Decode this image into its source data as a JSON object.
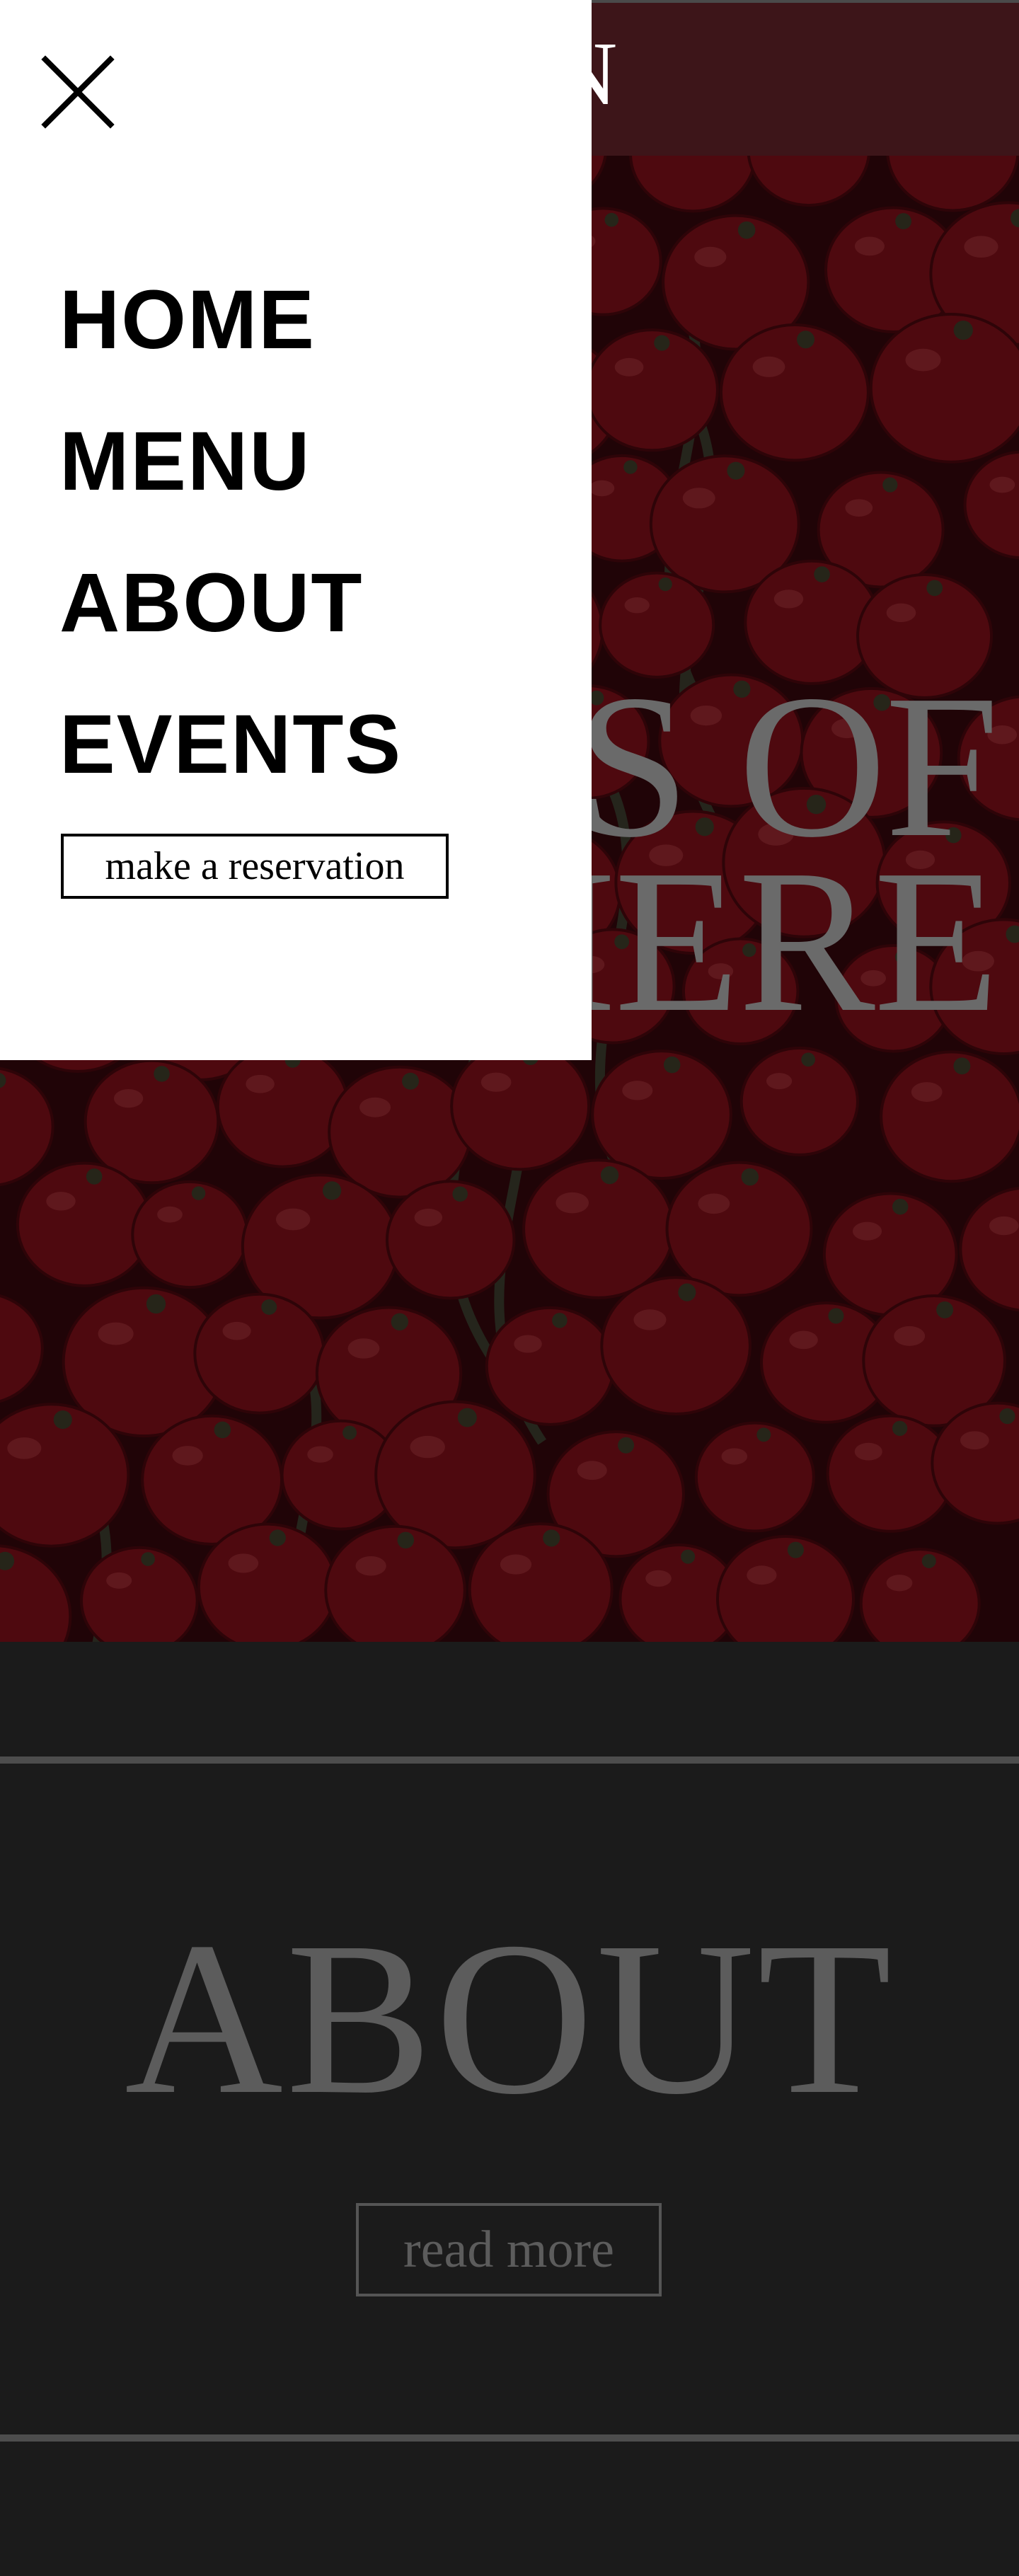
{
  "header": {
    "logo_text": "N"
  },
  "hero": {
    "title_line_1": "S OF",
    "title_line_2": "HERE"
  },
  "menu": {
    "items": [
      {
        "label": "HOME"
      },
      {
        "label": "MENU"
      },
      {
        "label": "ABOUT"
      },
      {
        "label": "EVENTS"
      }
    ],
    "reservation_label": "make a reservation",
    "close_icon": "close-icon"
  },
  "about": {
    "title": "ABOUT",
    "read_more_label": "read more"
  },
  "colors": {
    "overlay_red": "#3d1519",
    "tomato": "#6e0e16",
    "background_dark": "#1b1b1b",
    "text_gray": "#5c5c5c",
    "panel_white": "#ffffff"
  }
}
